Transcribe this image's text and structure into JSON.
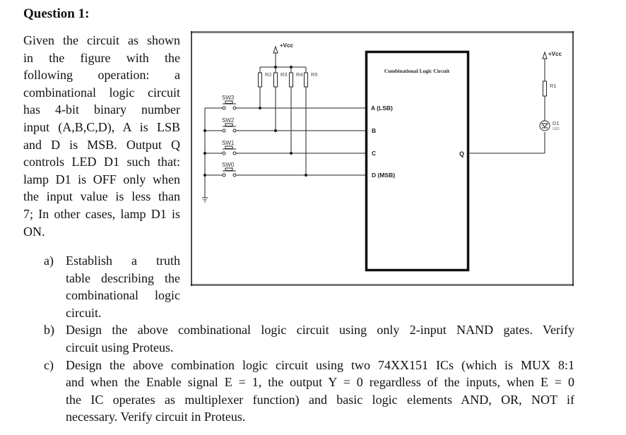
{
  "question": {
    "title": "Question 1:",
    "intro_lines": [
      "Given the circuit as shown",
      "in the figure with the",
      "following operation: a",
      "combinational logic circuit",
      "has 4-bit binary number",
      "input (A,B,C,D), A is LSB",
      "and D is MSB. Output Q",
      "controls LED D1 such that:",
      "lamp D1 is OFF only when",
      "the input value is less than",
      "7; In other cases, lamp D1 is",
      "ON."
    ],
    "parts": [
      {
        "marker": "a)",
        "lines": [
          "Establish a truth",
          "table describing the",
          "combinational logic",
          "circuit."
        ]
      },
      {
        "marker": "b)",
        "lines": [
          "Design the above combinational logic circuit using only 2-input NAND gates. Verify",
          "circuit using Proteus."
        ]
      },
      {
        "marker": "c)",
        "lines": [
          "Design the above combination logic circuit using two 74XX151 ICs (which is MUX 8:1",
          "and when the Enable signal E = 1, the output Y = 0 regardless of the inputs, when E = 0",
          "the IC operates as multiplexer function) and basic logic elements AND, OR, NOT if",
          "necessary. Verify circuit in Proteus."
        ]
      }
    ]
  },
  "circuit": {
    "vcc_left": "+Vcc",
    "vcc_right": "+Vcc",
    "resistors": [
      "R2",
      "R3",
      "R4",
      "R5"
    ],
    "switches": [
      "SW3",
      "SW2",
      "SW1",
      "SW0"
    ],
    "block_title": "Combinational Logic Circuit",
    "inputs": [
      "A (LSB)",
      "B",
      "C",
      "D (MSB)"
    ],
    "output": "Q",
    "r1": "R1",
    "led_label": "D1",
    "led_sub": "LED"
  }
}
